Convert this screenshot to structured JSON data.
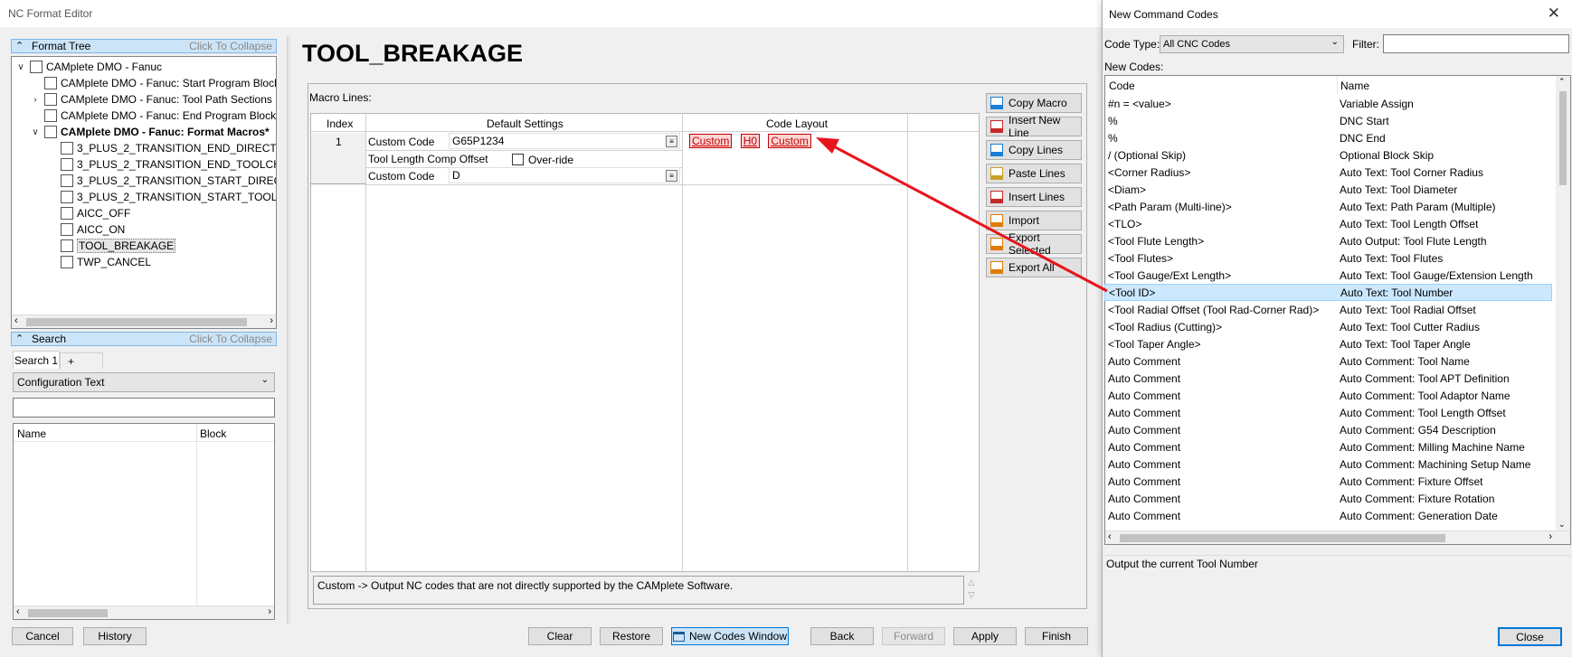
{
  "left_window": {
    "title": "NC Format Editor",
    "format_tree_header": "Format Tree",
    "collapse_hint": "Click To Collapse",
    "tree": [
      {
        "label": "CAMplete DMO - Fanuc",
        "level": 0,
        "expander": "v",
        "bold": false
      },
      {
        "label": "CAMplete DMO - Fanuc: Start Program Block",
        "level": 1,
        "expander": "",
        "bold": false
      },
      {
        "label": "CAMplete DMO - Fanuc: Tool Path Sections",
        "level": 1,
        "expander": ">",
        "bold": false
      },
      {
        "label": "CAMplete DMO - Fanuc: End Program Block",
        "level": 1,
        "expander": "",
        "bold": false
      },
      {
        "label": "CAMplete DMO - Fanuc: Format Macros*",
        "level": 1,
        "expander": "v",
        "bold": true
      },
      {
        "label": "3_PLUS_2_TRANSITION_END_DIRECT",
        "level": 2,
        "expander": "",
        "bold": false
      },
      {
        "label": "3_PLUS_2_TRANSITION_END_TOOLCHANGE",
        "level": 2,
        "expander": "",
        "bold": false
      },
      {
        "label": "3_PLUS_2_TRANSITION_START_DIRECT",
        "level": 2,
        "expander": "",
        "bold": false
      },
      {
        "label": "3_PLUS_2_TRANSITION_START_TOOLCHANGE",
        "level": 2,
        "expander": "",
        "bold": false
      },
      {
        "label": "AICC_OFF",
        "level": 2,
        "expander": "",
        "bold": false
      },
      {
        "label": "AICC_ON",
        "level": 2,
        "expander": "",
        "bold": false
      },
      {
        "label": "TOOL_BREAKAGE",
        "level": 2,
        "expander": "",
        "bold": false,
        "selected": true
      },
      {
        "label": "TWP_CANCEL",
        "level": 2,
        "expander": "",
        "bold": false
      }
    ],
    "search_header": "Search",
    "search_tab": "Search 1",
    "search_tab_add": "+",
    "search_type": "Configuration Text",
    "search_value": "",
    "result_cols": [
      "Name",
      "Block"
    ],
    "macro_title": "TOOL_BREAKAGE",
    "macro_lines_label": "Macro Lines:",
    "grid_cols": {
      "index": "Index",
      "default": "Default Settings",
      "layout": "Code Layout"
    },
    "grid_row": {
      "index": "1",
      "custom_label_1": "Custom Code",
      "custom_value_1": "G65P1234",
      "tlo_label": "Tool Length Comp Offset",
      "override_label": "Over-ride",
      "custom_label_2": "Custom Code",
      "custom_value_2": "D",
      "layout_codes": [
        "Custom",
        "H0",
        "Custom"
      ]
    },
    "side_buttons": [
      "Copy Macro",
      "Insert New Line",
      "Copy Lines",
      "Paste Lines",
      "Insert Lines",
      "Import",
      "Export Selected",
      "Export All"
    ],
    "description": "Custom -> Output NC codes that are not directly supported by the CAMplete Software.",
    "bottom_buttons": {
      "cancel": "Cancel",
      "history": "History",
      "clear": "Clear",
      "restore": "Restore",
      "new_codes": "New Codes Window",
      "back": "Back",
      "forward": "Forward",
      "apply": "Apply",
      "finish": "Finish"
    }
  },
  "right_window": {
    "title": "New Command Codes",
    "code_type_label": "Code Type:",
    "code_type_value": "All CNC Codes",
    "filter_label": "Filter:",
    "filter_value": "",
    "new_codes_label": "New Codes:",
    "cols": [
      "Code",
      "Name"
    ],
    "rows": [
      {
        "code": "#n = <value>",
        "name": "Variable Assign"
      },
      {
        "code": "%",
        "name": "DNC Start"
      },
      {
        "code": "%",
        "name": "DNC End"
      },
      {
        "code": "/ (Optional Skip)",
        "name": "Optional Block Skip"
      },
      {
        "code": "<Corner Radius>",
        "name": "Auto Text: Tool Corner Radius"
      },
      {
        "code": "<Diam>",
        "name": "Auto Text: Tool Diameter"
      },
      {
        "code": "<Path Param (Multi-line)>",
        "name": "Auto Text: Path Param (Multiple)"
      },
      {
        "code": "<TLO>",
        "name": "Auto Text: Tool Length Offset"
      },
      {
        "code": "<Tool Flute Length>",
        "name": "Auto Output: Tool Flute Length"
      },
      {
        "code": "<Tool Flutes>",
        "name": "Auto Text: Tool Flutes"
      },
      {
        "code": "<Tool Gauge/Ext Length>",
        "name": "Auto Text: Tool Gauge/Extension Length"
      },
      {
        "code": "<Tool ID>",
        "name": "Auto Text: Tool Number",
        "selected": true
      },
      {
        "code": "<Tool Radial Offset (Tool Rad-Corner Rad)>",
        "name": "Auto Text: Tool Radial Offset"
      },
      {
        "code": "<Tool Radius (Cutting)>",
        "name": "Auto Text: Tool Cutter Radius"
      },
      {
        "code": "<Tool Taper Angle>",
        "name": "Auto Text: Tool Taper Angle"
      },
      {
        "code": "Auto Comment",
        "name": "Auto Comment: Tool Name"
      },
      {
        "code": "Auto Comment",
        "name": "Auto Comment: Tool APT Definition"
      },
      {
        "code": "Auto Comment",
        "name": "Auto Comment: Tool Adaptor Name"
      },
      {
        "code": "Auto Comment",
        "name": "Auto Comment: Tool Length Offset"
      },
      {
        "code": "Auto Comment",
        "name": "Auto Comment: G54 Description"
      },
      {
        "code": "Auto Comment",
        "name": "Auto Comment: Milling Machine Name"
      },
      {
        "code": "Auto Comment",
        "name": "Auto Comment: Machining Setup Name"
      },
      {
        "code": "Auto Comment",
        "name": "Auto Comment: Fixture Offset"
      },
      {
        "code": "Auto Comment",
        "name": "Auto Comment: Fixture Rotation"
      },
      {
        "code": "Auto Comment",
        "name": "Auto Comment: Generation Date"
      }
    ],
    "description": "Output the current Tool Number",
    "close_label": "Close"
  },
  "colors": {
    "selection": "#cce8ff",
    "arrow": "#e8141c",
    "header_blue": "#cce4f7"
  }
}
